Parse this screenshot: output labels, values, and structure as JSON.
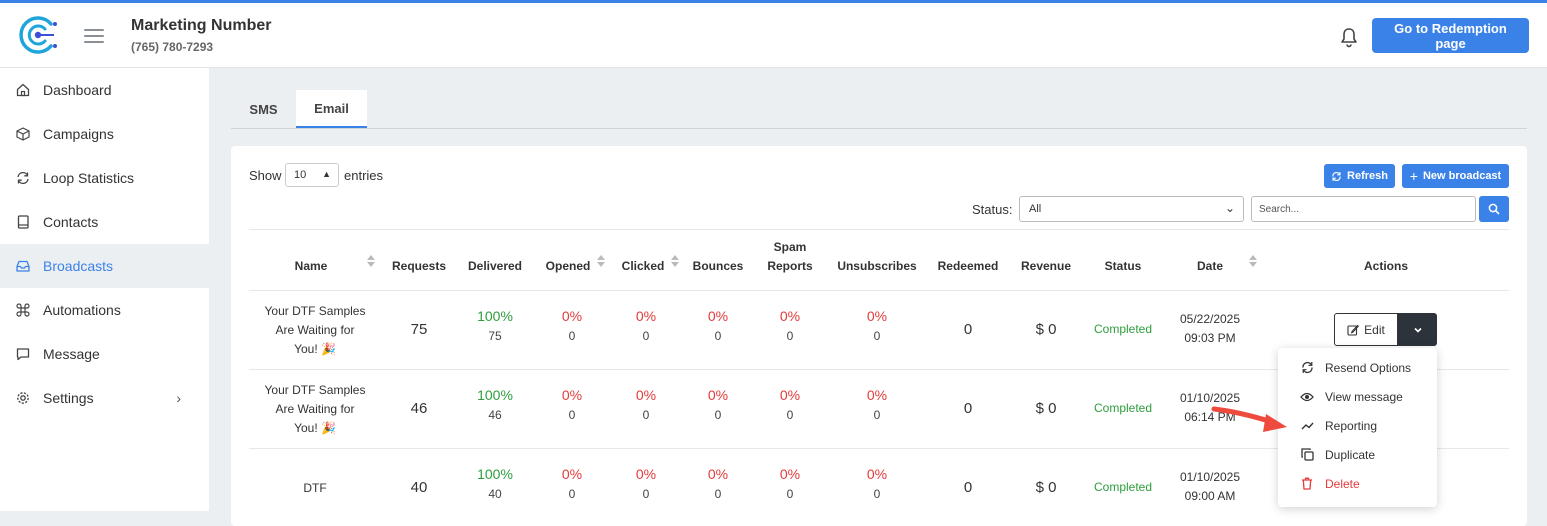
{
  "header": {
    "title": "Marketing Number",
    "phone": "(765) 780-7293",
    "redemption_button": "Go to Redemption page"
  },
  "sidebar": {
    "items": [
      {
        "label": "Dashboard",
        "icon": "home-icon"
      },
      {
        "label": "Campaigns",
        "icon": "box-icon"
      },
      {
        "label": "Loop Statistics",
        "icon": "loop-icon"
      },
      {
        "label": "Contacts",
        "icon": "book-icon"
      },
      {
        "label": "Broadcasts",
        "icon": "inbox-icon",
        "active": true
      },
      {
        "label": "Automations",
        "icon": "command-icon"
      },
      {
        "label": "Message",
        "icon": "chat-icon"
      },
      {
        "label": "Settings",
        "icon": "gear-icon"
      }
    ]
  },
  "tabs": {
    "sms": "SMS",
    "email": "Email",
    "active": "Email"
  },
  "table_controls": {
    "show_label": "Show",
    "entries_value": "10",
    "entries_label": "entries",
    "refresh_button": "Refresh",
    "new_broadcast_button": "New broadcast",
    "status_label": "Status:",
    "status_value": "All",
    "search_placeholder": "Search..."
  },
  "columns": {
    "name": "Name",
    "requests": "Requests",
    "delivered": "Delivered",
    "opened": "Opened",
    "clicked": "Clicked",
    "bounces": "Bounces",
    "spam_line1": "Spam",
    "spam_line2": "Reports",
    "unsubscribes": "Unsubscribes",
    "redeemed": "Redeemed",
    "revenue": "Revenue",
    "status": "Status",
    "date": "Date",
    "actions": "Actions"
  },
  "rows": [
    {
      "name_lines": [
        "Your DTF Samples",
        "Are Waiting for",
        "You! 🎉"
      ],
      "requests": "75",
      "delivered_pct": "100%",
      "delivered": "75",
      "opened_pct": "0%",
      "opened": "0",
      "clicked_pct": "0%",
      "clicked": "0",
      "bounces_pct": "0%",
      "bounces": "0",
      "spam_pct": "0%",
      "spam": "0",
      "unsub_pct": "0%",
      "unsub": "0",
      "redeemed": "0",
      "revenue": "$ 0",
      "status": "Completed",
      "date": "05/22/2025",
      "time": "09:03 PM"
    },
    {
      "name_lines": [
        "Your DTF Samples",
        "Are Waiting for",
        "You! 🎉"
      ],
      "requests": "46",
      "delivered_pct": "100%",
      "delivered": "46",
      "opened_pct": "0%",
      "opened": "0",
      "clicked_pct": "0%",
      "clicked": "0",
      "bounces_pct": "0%",
      "bounces": "0",
      "spam_pct": "0%",
      "spam": "0",
      "unsub_pct": "0%",
      "unsub": "0",
      "redeemed": "0",
      "revenue": "$ 0",
      "status": "Completed",
      "date": "01/10/2025",
      "time": "06:14 PM"
    },
    {
      "name_lines": [
        "DTF"
      ],
      "requests": "40",
      "delivered_pct": "100%",
      "delivered": "40",
      "opened_pct": "0%",
      "opened": "0",
      "clicked_pct": "0%",
      "clicked": "0",
      "bounces_pct": "0%",
      "bounces": "0",
      "spam_pct": "0%",
      "spam": "0",
      "unsub_pct": "0%",
      "unsub": "0",
      "redeemed": "0",
      "revenue": "$ 0",
      "status": "Completed",
      "date": "01/10/2025",
      "time": "09:00 AM"
    }
  ],
  "actions": {
    "edit_label": "Edit",
    "menu": [
      {
        "label": "Resend Options",
        "icon": "resend-icon"
      },
      {
        "label": "View message",
        "icon": "eye-icon"
      },
      {
        "label": "Reporting",
        "icon": "trend-line-icon"
      },
      {
        "label": "Duplicate",
        "icon": "copy-icon"
      },
      {
        "label": "Delete",
        "icon": "trash-icon",
        "danger": true
      }
    ]
  },
  "colors": {
    "accent": "#3b82e8",
    "success": "#2e9e3c",
    "danger": "#e33b3b",
    "annotation_arrow": "#ef4a3e"
  }
}
